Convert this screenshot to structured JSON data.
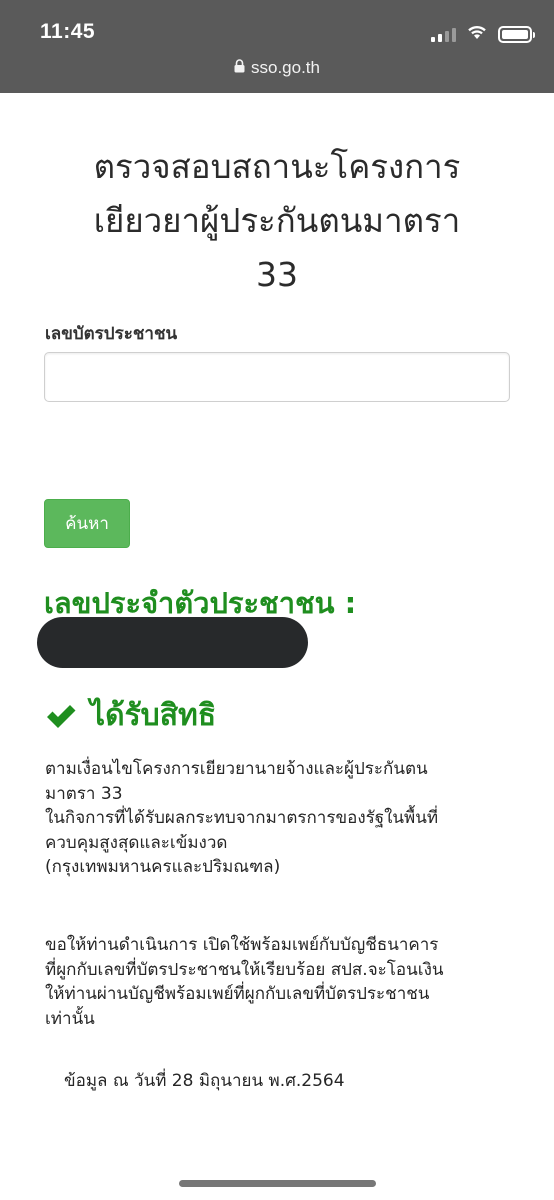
{
  "status_bar": {
    "time": "11:45",
    "url": "sso.go.th",
    "icons": [
      "signal-icon",
      "wifi-icon",
      "battery-icon",
      "lock-icon"
    ]
  },
  "page": {
    "title_line1": "ตรวจสอบสถานะโครงการ",
    "title_line2": "เยียวยาผู้ประกันตนมาตรา",
    "title_line3": "33"
  },
  "form": {
    "id_label": "เลขบัตรประชาชน",
    "id_value": "",
    "search_label": "ค้นหา"
  },
  "result": {
    "id_heading": "เลขประจำตัวประชาชน :",
    "status": "ได้รับสิทธิ",
    "status_icon": "check-icon",
    "para1_line1": "ตามเงื่อนไขโครงการเยียวยานายจ้างและผู้ประกันตน",
    "para1_line2": "มาตรา 33",
    "para1_line3": "ในกิจการที่ได้รับผลกระทบจากมาตรการของรัฐในพื้นที่",
    "para1_line4": "ควบคุมสูงสุดและเข้มงวด",
    "para1_line5": "(กรุงเทพมหานครและปริมณฑล)",
    "para2_line1": "ขอให้ท่านดำเนินการ เปิดใช้พร้อมเพย์กับบัญชีธนาคาร",
    "para2_line2": "ที่ผูกกับเลขที่บัตรประชาชนให้เรียบร้อย สปส.จะโอนเงิน",
    "para2_line3": "ให้ท่านผ่านบัญชีพร้อมเพย์ที่ผูกกับเลขที่บัตรประชาชน",
    "para2_line4": "เท่านั้น",
    "data_date": "ข้อมูล ณ วันที่ 28 มิถุนายน พ.ศ.2564"
  },
  "colors": {
    "status_bar_bg": "#5a5a5a",
    "success_green": "#1f8e1f",
    "button_green": "#5cb85c",
    "redaction": "#27292b"
  }
}
